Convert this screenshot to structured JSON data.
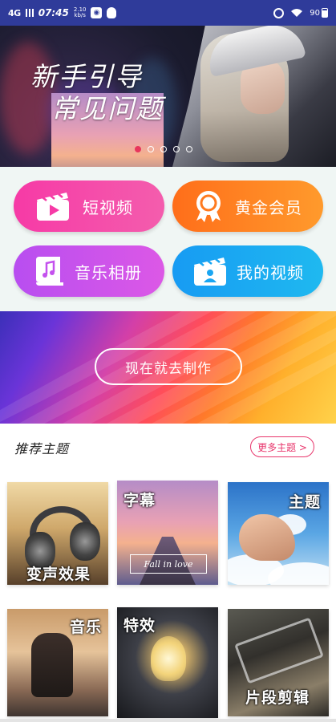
{
  "status_bar": {
    "signal": "4G",
    "time": "07:45",
    "speed_value": "2.10",
    "speed_unit": "kb/s",
    "battery": "90"
  },
  "banner": {
    "title_line1": "新手引导",
    "title_line2": "常见问题",
    "dots_count": 5,
    "active_dot": 0
  },
  "features": [
    {
      "label": "短视频",
      "icon": "clapperboard-play-icon",
      "color": "#f63aa6"
    },
    {
      "label": "黄金会员",
      "icon": "medal-award-icon",
      "color": "#ff7a1f"
    },
    {
      "label": "音乐相册",
      "icon": "music-book-icon",
      "color": "#c451ee"
    },
    {
      "label": "我的视频",
      "icon": "user-film-icon",
      "color": "#1aa6f2"
    }
  ],
  "promo": {
    "button_label": "现在就去制作"
  },
  "topics": {
    "title": "推荐主题",
    "more_label": "更多主题 >",
    "accent": "#e8366c",
    "items": [
      {
        "label": "变声效果"
      },
      {
        "label": "字幕",
        "caption": "Fall in love"
      },
      {
        "label": "主题"
      },
      {
        "label": "音乐"
      },
      {
        "label": "特效"
      },
      {
        "label": "片段剪辑"
      }
    ]
  }
}
